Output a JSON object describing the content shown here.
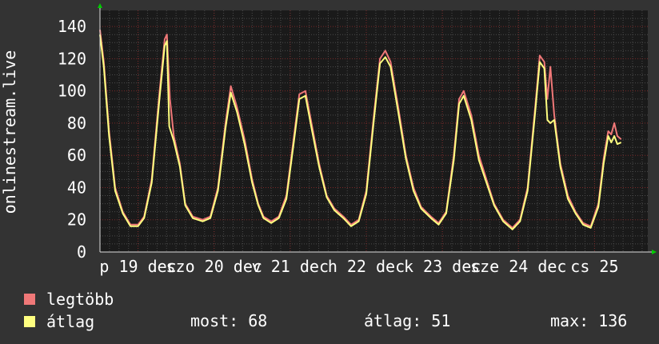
{
  "chart_data": {
    "type": "line",
    "ylabel": "onlinestream.live",
    "ylim": [
      0,
      150
    ],
    "yticks": [
      0,
      20,
      40,
      60,
      80,
      100,
      120,
      140
    ],
    "xlim": [
      0,
      7.2
    ],
    "xtick_labels": [
      {
        "x": 0.5,
        "label": "p 19 dec"
      },
      {
        "x": 1.5,
        "label": "szo 20 dec"
      },
      {
        "x": 2.5,
        "label": "v 21 dec"
      },
      {
        "x": 3.5,
        "label": "h 22 dec"
      },
      {
        "x": 4.5,
        "label": "k 23 dec"
      },
      {
        "x": 5.5,
        "label": "sze 24 dec"
      },
      {
        "x": 6.5,
        "label": "cs 25"
      }
    ],
    "grid": true,
    "colors": {
      "background": "#333333",
      "plot": "#1a1a1a",
      "legtobb": "#f07878",
      "atlag": "#ffff80",
      "grid_major": "#7a2828",
      "grid_minor": "#4a4a4a",
      "axis": "#dddddd",
      "arrow": "#00cc00"
    },
    "series": [
      {
        "name": "legtöbb",
        "values": [
          [
            0.0,
            138
          ],
          [
            0.05,
            118
          ],
          [
            0.12,
            75
          ],
          [
            0.2,
            40
          ],
          [
            0.3,
            25
          ],
          [
            0.4,
            17
          ],
          [
            0.5,
            17
          ],
          [
            0.58,
            22
          ],
          [
            0.68,
            45
          ],
          [
            0.78,
            98
          ],
          [
            0.85,
            132
          ],
          [
            0.88,
            135
          ],
          [
            0.92,
            95
          ],
          [
            0.97,
            72
          ],
          [
            1.05,
            55
          ],
          [
            1.12,
            30
          ],
          [
            1.22,
            22
          ],
          [
            1.35,
            20
          ],
          [
            1.45,
            22
          ],
          [
            1.55,
            40
          ],
          [
            1.65,
            80
          ],
          [
            1.72,
            103
          ],
          [
            1.8,
            90
          ],
          [
            1.9,
            70
          ],
          [
            2.0,
            45
          ],
          [
            2.08,
            30
          ],
          [
            2.15,
            22
          ],
          [
            2.25,
            19
          ],
          [
            2.35,
            22
          ],
          [
            2.45,
            35
          ],
          [
            2.55,
            72
          ],
          [
            2.62,
            98
          ],
          [
            2.7,
            100
          ],
          [
            2.78,
            80
          ],
          [
            2.88,
            55
          ],
          [
            2.98,
            35
          ],
          [
            3.08,
            27
          ],
          [
            3.2,
            22
          ],
          [
            3.3,
            17
          ],
          [
            3.4,
            20
          ],
          [
            3.5,
            38
          ],
          [
            3.6,
            85
          ],
          [
            3.68,
            120
          ],
          [
            3.75,
            125
          ],
          [
            3.82,
            118
          ],
          [
            3.92,
            90
          ],
          [
            4.02,
            60
          ],
          [
            4.12,
            40
          ],
          [
            4.22,
            28
          ],
          [
            4.35,
            22
          ],
          [
            4.45,
            18
          ],
          [
            4.55,
            25
          ],
          [
            4.65,
            60
          ],
          [
            4.72,
            95
          ],
          [
            4.78,
            100
          ],
          [
            4.88,
            85
          ],
          [
            4.98,
            60
          ],
          [
            5.08,
            45
          ],
          [
            5.18,
            30
          ],
          [
            5.3,
            20
          ],
          [
            5.42,
            15
          ],
          [
            5.52,
            20
          ],
          [
            5.62,
            40
          ],
          [
            5.72,
            90
          ],
          [
            5.78,
            122
          ],
          [
            5.84,
            118
          ],
          [
            5.88,
            95
          ],
          [
            5.92,
            115
          ],
          [
            5.97,
            85
          ],
          [
            6.05,
            55
          ],
          [
            6.15,
            35
          ],
          [
            6.25,
            25
          ],
          [
            6.35,
            18
          ],
          [
            6.45,
            16
          ],
          [
            6.55,
            30
          ],
          [
            6.62,
            58
          ],
          [
            6.68,
            75
          ],
          [
            6.72,
            73
          ],
          [
            6.76,
            80
          ],
          [
            6.8,
            72
          ],
          [
            6.85,
            70
          ]
        ]
      },
      {
        "name": "átlag",
        "values": [
          [
            0.0,
            135
          ],
          [
            0.05,
            115
          ],
          [
            0.12,
            72
          ],
          [
            0.2,
            38
          ],
          [
            0.3,
            24
          ],
          [
            0.4,
            16
          ],
          [
            0.5,
            16
          ],
          [
            0.58,
            21
          ],
          [
            0.68,
            43
          ],
          [
            0.78,
            94
          ],
          [
            0.85,
            128
          ],
          [
            0.88,
            131
          ],
          [
            0.91,
            78
          ],
          [
            0.97,
            69
          ],
          [
            1.05,
            53
          ],
          [
            1.12,
            29
          ],
          [
            1.22,
            21
          ],
          [
            1.35,
            19
          ],
          [
            1.45,
            21
          ],
          [
            1.55,
            38
          ],
          [
            1.65,
            77
          ],
          [
            1.72,
            99
          ],
          [
            1.8,
            87
          ],
          [
            1.9,
            67
          ],
          [
            2.0,
            43
          ],
          [
            2.08,
            29
          ],
          [
            2.15,
            21
          ],
          [
            2.25,
            18
          ],
          [
            2.35,
            21
          ],
          [
            2.45,
            33
          ],
          [
            2.55,
            69
          ],
          [
            2.62,
            95
          ],
          [
            2.7,
            97
          ],
          [
            2.78,
            77
          ],
          [
            2.88,
            53
          ],
          [
            2.98,
            34
          ],
          [
            3.08,
            26
          ],
          [
            3.2,
            21
          ],
          [
            3.3,
            16
          ],
          [
            3.4,
            19
          ],
          [
            3.5,
            36
          ],
          [
            3.6,
            82
          ],
          [
            3.68,
            117
          ],
          [
            3.75,
            121
          ],
          [
            3.82,
            115
          ],
          [
            3.92,
            87
          ],
          [
            4.02,
            58
          ],
          [
            4.12,
            38
          ],
          [
            4.22,
            27
          ],
          [
            4.35,
            21
          ],
          [
            4.45,
            17
          ],
          [
            4.55,
            24
          ],
          [
            4.65,
            57
          ],
          [
            4.72,
            92
          ],
          [
            4.78,
            97
          ],
          [
            4.88,
            82
          ],
          [
            4.98,
            57
          ],
          [
            5.08,
            43
          ],
          [
            5.18,
            29
          ],
          [
            5.3,
            19
          ],
          [
            5.42,
            14
          ],
          [
            5.52,
            19
          ],
          [
            5.62,
            38
          ],
          [
            5.72,
            87
          ],
          [
            5.78,
            118
          ],
          [
            5.84,
            114
          ],
          [
            5.88,
            82
          ],
          [
            5.92,
            80
          ],
          [
            5.97,
            82
          ],
          [
            6.05,
            53
          ],
          [
            6.15,
            33
          ],
          [
            6.25,
            24
          ],
          [
            6.35,
            17
          ],
          [
            6.45,
            15
          ],
          [
            6.55,
            28
          ],
          [
            6.62,
            55
          ],
          [
            6.68,
            72
          ],
          [
            6.72,
            68
          ],
          [
            6.76,
            72
          ],
          [
            6.8,
            67
          ],
          [
            6.85,
            68
          ]
        ]
      }
    ]
  },
  "legend": [
    {
      "label": "legtöbb",
      "color": "#f07878"
    },
    {
      "label": "átlag",
      "color": "#ffff80"
    }
  ],
  "stats": {
    "most": "most: 68",
    "atlag": "átlag: 51",
    "max": "max: 136"
  }
}
